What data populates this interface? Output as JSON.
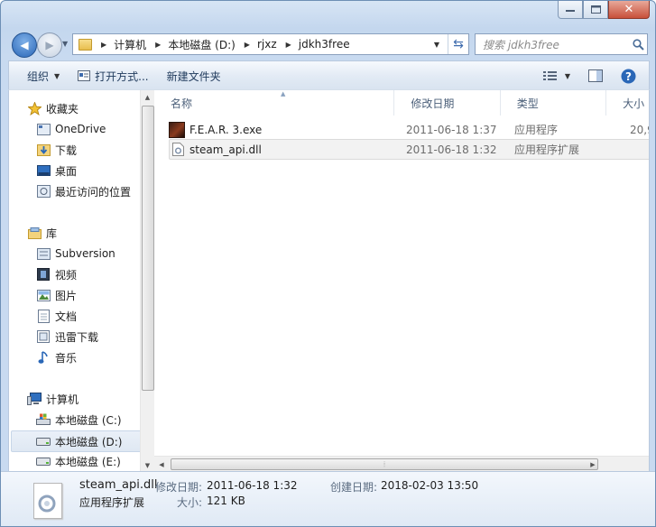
{
  "window": {
    "caption": {
      "minimize": "minimize",
      "maximize": "maximize",
      "close": "close"
    }
  },
  "address": {
    "breadcrumbs": [
      "计算机",
      "本地磁盘 (D:)",
      "rjxz",
      "jdkh3free"
    ]
  },
  "search": {
    "placeholder": "搜索 jdkh3free"
  },
  "toolbar": {
    "organize": "组织",
    "open_with": "打开方式...",
    "new_folder": "新建文件夹"
  },
  "nav": {
    "favorites": {
      "label": "收藏夹",
      "items": [
        "OneDrive",
        "下载",
        "桌面",
        "最近访问的位置"
      ]
    },
    "libraries": {
      "label": "库",
      "items": [
        "Subversion",
        "视频",
        "图片",
        "文档",
        "迅雷下载",
        "音乐"
      ]
    },
    "computer": {
      "label": "计算机",
      "items": [
        "本地磁盘 (C:)",
        "本地磁盘 (D:)",
        "本地磁盘 (E:)"
      ],
      "selected": "本地磁盘 (D:)"
    }
  },
  "columns": [
    "名称",
    "修改日期",
    "类型",
    "大小"
  ],
  "files": [
    {
      "name": "F.E.A.R. 3.exe",
      "modified": "2011-06-18 1:37",
      "type": "应用程序",
      "size": "20,9",
      "selected": false
    },
    {
      "name": "steam_api.dll",
      "modified": "2011-06-18 1:32",
      "type": "应用程序扩展",
      "size": "",
      "selected": true
    }
  ],
  "details": {
    "filename": "steam_api.dll",
    "filetype": "应用程序扩展",
    "modified_label": "修改日期:",
    "modified_value": "2011-06-18 1:32",
    "created_label": "创建日期:",
    "created_value": "2018-02-03 13:50",
    "size_label": "大小:",
    "size_value": "121 KB"
  },
  "colors": {
    "accent": "#2a67b7",
    "toolbar_text": "#1e395b",
    "selection": "#f2f2f2"
  }
}
